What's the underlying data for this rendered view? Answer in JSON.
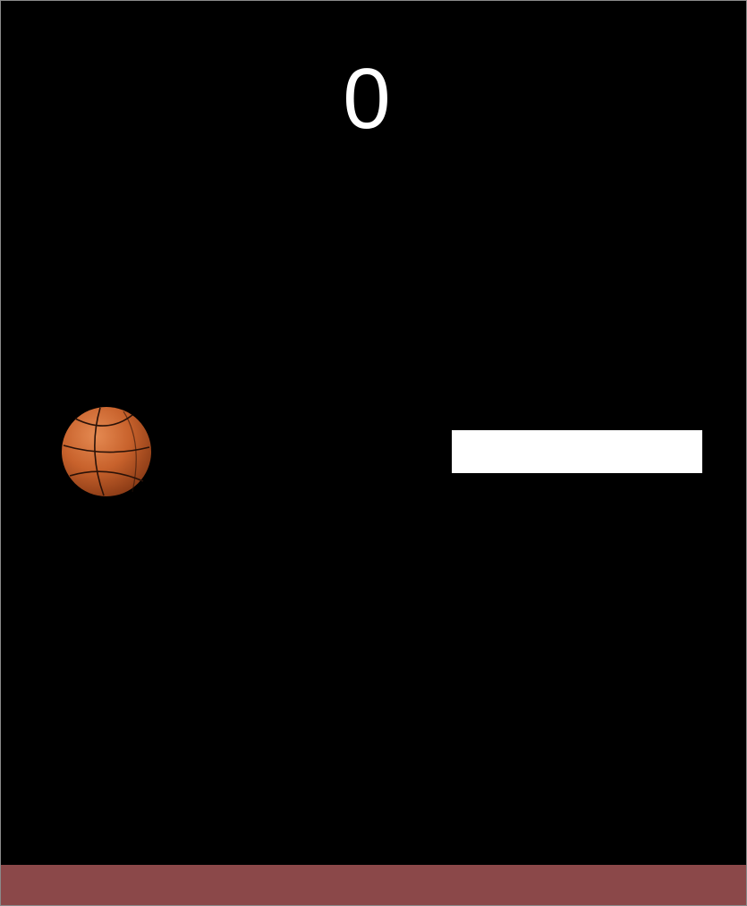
{
  "hud": {
    "score": "0"
  },
  "entities": {
    "ball_icon": "basketball-icon",
    "platform_color": "#ffffff",
    "ground_color": "#8b4849",
    "background_color": "#000000"
  }
}
